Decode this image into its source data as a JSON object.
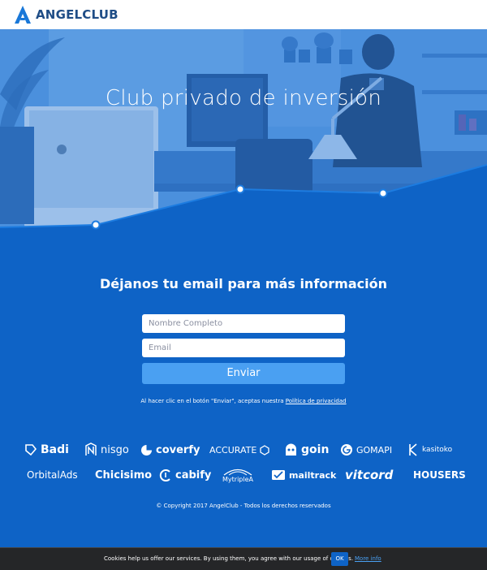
{
  "brand": {
    "name": "ANGELCLUB"
  },
  "hero": {
    "title": "Club privado de inversión"
  },
  "form": {
    "heading": "Déjanos tu email para más información",
    "name_placeholder": "Nombre Completo",
    "email_placeholder": "Email",
    "submit_label": "Enviar",
    "legal_text": "Al hacer clic en el botón \"Enviar\", aceptas nuestra ",
    "privacy_link": "Política de privacidad"
  },
  "partners": {
    "row1": [
      "Badi",
      "nisgo",
      "coverfy",
      "ACCURATE",
      "goin",
      "GOMAPI",
      "kasitoko"
    ],
    "row2": [
      "OrbitalAds",
      "Chicisimo",
      "cabify",
      "MytripleA",
      "mailtrack",
      "vitcord",
      "HOUSERS"
    ]
  },
  "footer": {
    "copyright": "© Copyright 2017 AngelClub - Todos los derechos reservados"
  },
  "cookie_bar": {
    "message": "Cookies help us offer our services. By using them, you agree with our usage of cookies.",
    "ok_label": "OK",
    "more_label": "More info"
  },
  "colors": {
    "primary_blue": "#0e63c6",
    "button_blue": "#4aa0f2",
    "cookie_bg": "#252628"
  }
}
